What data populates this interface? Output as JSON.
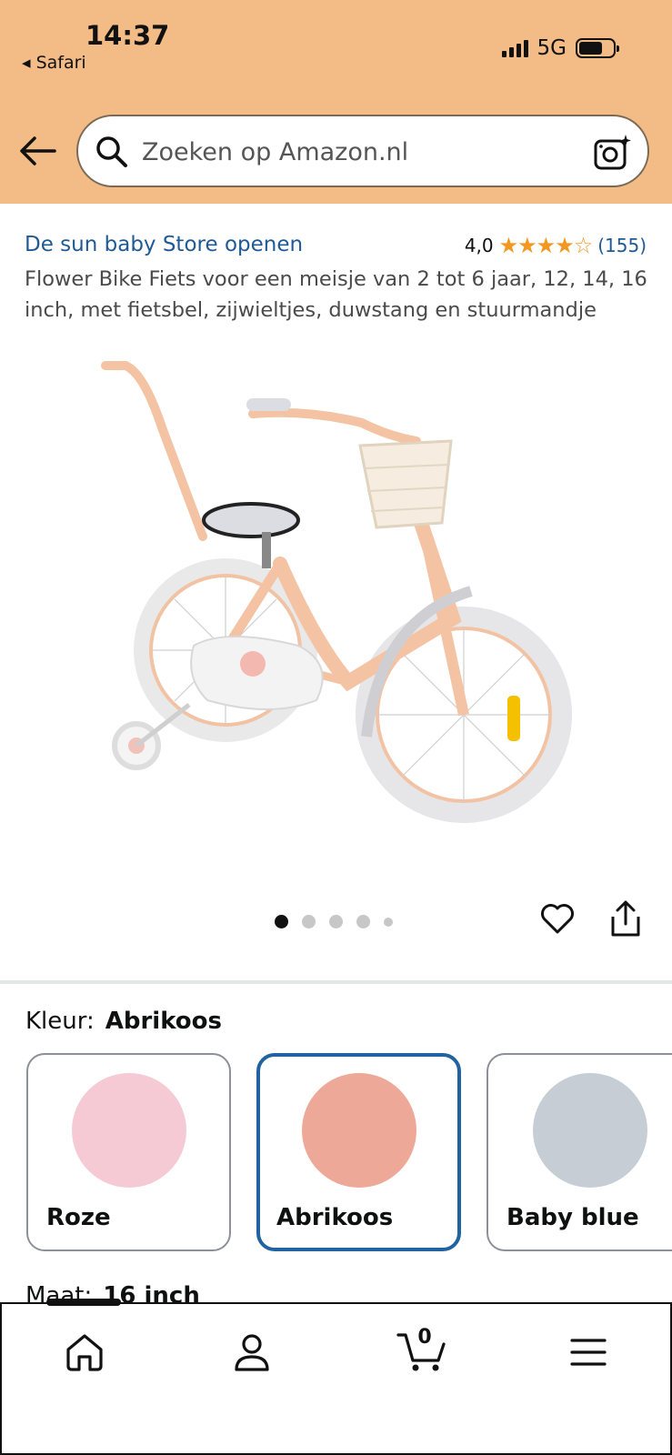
{
  "status_bar": {
    "time": "14:37",
    "back_app": "◂ Safari",
    "network": "5G"
  },
  "search": {
    "placeholder": "Zoeken op Amazon.nl"
  },
  "product": {
    "store_link": "De sun baby Store openen",
    "rating": "4,0",
    "stars": "★★★★☆",
    "rating_count": "(155)",
    "title": "Flower Bike Fiets voor een meisje van 2 tot 6 jaar, 12, 14, 16 inch, met fietsbel, zijwieltjes, duwstang en stuurmandje",
    "image_count": 5,
    "active_image": 1
  },
  "variations": {
    "color_label": "Kleur:",
    "color_selected": "Abrikoos",
    "colors": [
      {
        "name": "Roze",
        "hex": "#f5cad5",
        "selected": false
      },
      {
        "name": "Abrikoos",
        "hex": "#eea898",
        "selected": true
      },
      {
        "name": "Baby blue",
        "hex": "#c7cdd5",
        "selected": false
      }
    ],
    "size_label": "Maat:",
    "size_selected": "16 inch"
  },
  "tabbar": {
    "cart_count": "0",
    "icons": [
      "home-icon",
      "account-icon",
      "cart-icon",
      "menu-icon"
    ]
  },
  "colors": {
    "header_bg": "#f3bc86",
    "link": "#1f5a96",
    "star": "#f39720",
    "selected_border": "#2162a1"
  }
}
